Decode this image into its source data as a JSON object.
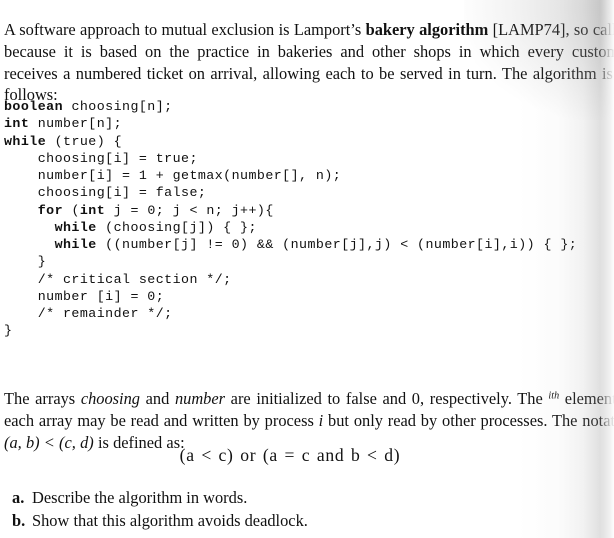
{
  "document": {
    "type": "textbook-page-scan",
    "page_background": "#ffffff",
    "text_color": "#111111"
  },
  "intro_paragraph": {
    "run_1": "A software approach to mutual exclusion is Lamport’s ",
    "run_2_bold": "bakery algorithm",
    "run_3": " [LAMP74], so called because it is based on the practice in bakeries and other shops in which every customer receives a numbered ticket on arrival, allowing each to be served in turn. The algorithm is as follows:"
  },
  "code_listing": {
    "language": "java-like-pseudocode",
    "lines": [
      {
        "indent": 0,
        "keyword": "boolean",
        "rest": " choosing[n];"
      },
      {
        "indent": 0,
        "keyword": "int",
        "rest": " number[n];"
      },
      {
        "indent": 0,
        "keyword": "while",
        "rest": " (true) {"
      },
      {
        "indent": 4,
        "keyword": "",
        "rest": "choosing[i] = true;"
      },
      {
        "indent": 4,
        "keyword": "",
        "rest": "number[i] = 1 + getmax(number[], n);"
      },
      {
        "indent": 4,
        "keyword": "",
        "rest": "choosing[i] = false;"
      },
      {
        "indent": 4,
        "keyword": "for",
        "rest": " (",
        "keyword2": "int",
        "rest2": " j = 0; j < n; j++){"
      },
      {
        "indent": 6,
        "keyword": "while",
        "rest": " (choosing[j]) { };"
      },
      {
        "indent": 6,
        "keyword": "while",
        "rest": " ((number[j] != 0) && (number[j],j) < (number[i],i)) { };"
      },
      {
        "indent": 4,
        "keyword": "",
        "rest": "}"
      },
      {
        "indent": 4,
        "keyword": "",
        "rest": "/* critical section */;"
      },
      {
        "indent": 4,
        "keyword": "",
        "rest": "number [i] = 0;"
      },
      {
        "indent": 4,
        "keyword": "",
        "rest": "/* remainder */;"
      },
      {
        "indent": 0,
        "keyword": "",
        "rest": "}"
      }
    ]
  },
  "arrays_paragraph": {
    "run_1": "The arrays ",
    "italic_1": "choosing",
    "run_2": " and ",
    "italic_2": "number",
    "run_3": " are initialized to false and 0, respectively. The ",
    "superscript_ith": "ith",
    "run_4": " element of each array may be read and written by process ",
    "italic_3": "i",
    "run_5": " but only read by other processes. The notation ",
    "italic_4": "(a, b) < (c, d)",
    "run_6": " is defined as:"
  },
  "notation_formula": {
    "text": "(a < c) or (a = c and b < d)"
  },
  "question_list": {
    "items": [
      {
        "marker": "a.",
        "text": "Describe the algorithm in words."
      },
      {
        "marker": "b.",
        "text": "Show that this algorithm avoids deadlock."
      }
    ]
  }
}
